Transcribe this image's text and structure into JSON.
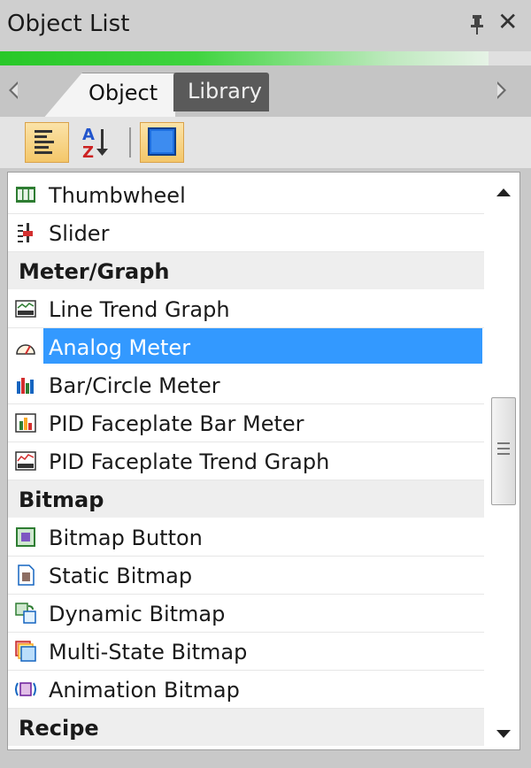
{
  "window": {
    "title": "Object List"
  },
  "progress": {
    "fraction": 0.92
  },
  "tabs": [
    {
      "label": "Object",
      "active": true
    },
    {
      "label": "Library",
      "active": false
    }
  ],
  "toolbar": {
    "buttons": [
      {
        "icon": "categorized-list-icon",
        "active": true
      },
      {
        "icon": "sort-az-icon",
        "active": false
      },
      {
        "icon": "view-toggle-icon",
        "active": true
      }
    ]
  },
  "list": {
    "items": [
      {
        "type": "item",
        "label": "Thumbwheel",
        "icon": "thumbwheel-icon"
      },
      {
        "type": "item",
        "label": "Slider",
        "icon": "slider-icon"
      },
      {
        "type": "category",
        "label": "Meter/Graph"
      },
      {
        "type": "item",
        "label": "Line Trend Graph",
        "icon": "line-trend-graph-icon"
      },
      {
        "type": "item",
        "label": "Analog Meter",
        "icon": "analog-meter-icon",
        "selected": true
      },
      {
        "type": "item",
        "label": "Bar/Circle Meter",
        "icon": "bar-circle-meter-icon"
      },
      {
        "type": "item",
        "label": "PID Faceplate Bar Meter",
        "icon": "pid-bar-meter-icon"
      },
      {
        "type": "item",
        "label": "PID Faceplate Trend Graph",
        "icon": "pid-trend-graph-icon"
      },
      {
        "type": "category",
        "label": "Bitmap"
      },
      {
        "type": "item",
        "label": "Bitmap Button",
        "icon": "bitmap-button-icon"
      },
      {
        "type": "item",
        "label": "Static Bitmap",
        "icon": "static-bitmap-icon"
      },
      {
        "type": "item",
        "label": "Dynamic Bitmap",
        "icon": "dynamic-bitmap-icon"
      },
      {
        "type": "item",
        "label": "Multi-State Bitmap",
        "icon": "multi-state-bitmap-icon"
      },
      {
        "type": "item",
        "label": "Animation Bitmap",
        "icon": "animation-bitmap-icon"
      },
      {
        "type": "category",
        "label": "Recipe"
      }
    ]
  },
  "colors": {
    "selection": "#3399ff",
    "active_toolbar": "#f4c76a",
    "progress": "#28c828"
  }
}
